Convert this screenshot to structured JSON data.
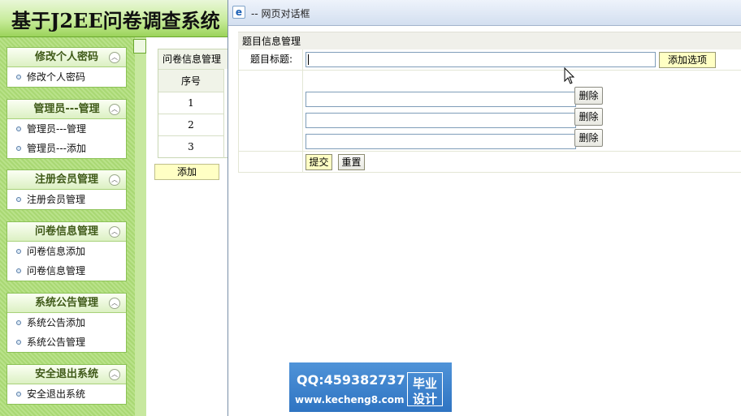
{
  "app": {
    "title": "基于J2EE问卷调查系统"
  },
  "sidebar": {
    "groups": [
      {
        "title": "修改个人密码",
        "items": [
          "修改个人密码"
        ]
      },
      {
        "title": "管理员---管理",
        "items": [
          "管理员---管理",
          "管理员---添加"
        ]
      },
      {
        "title": "注册会员管理",
        "items": [
          "注册会员管理"
        ]
      },
      {
        "title": "问卷信息管理",
        "items": [
          "问卷信息添加",
          "问卷信息管理"
        ]
      },
      {
        "title": "系统公告管理",
        "items": [
          "系统公告添加",
          "系统公告管理"
        ]
      },
      {
        "title": "安全退出系统",
        "items": [
          "安全退出系统"
        ]
      }
    ],
    "collapse_icon": "chevron-up-icon"
  },
  "main": {
    "list_title": "问卷信息管理",
    "column_header": "序号",
    "rows": [
      "1",
      "2",
      "3"
    ],
    "add_label": "添加"
  },
  "dialog": {
    "title": "-- 网页对话框",
    "form_header": "题目信息管理",
    "title_label": "题目标题:",
    "title_value": "",
    "add_option_label": "添加选项",
    "delete_label": "删除",
    "options": [
      "",
      "",
      ""
    ],
    "submit_label": "提交",
    "reset_label": "重置"
  },
  "watermark": {
    "qq": "QQ:459382737",
    "url": "www.kecheng8.com",
    "badge_line1": "毕业",
    "badge_line2": "设计"
  },
  "colors": {
    "header_green": "#9bd35a",
    "sidebar_green": "#b9e28a",
    "button_yellow": "#ffffc4",
    "watermark_blue": "#3a80cc"
  }
}
